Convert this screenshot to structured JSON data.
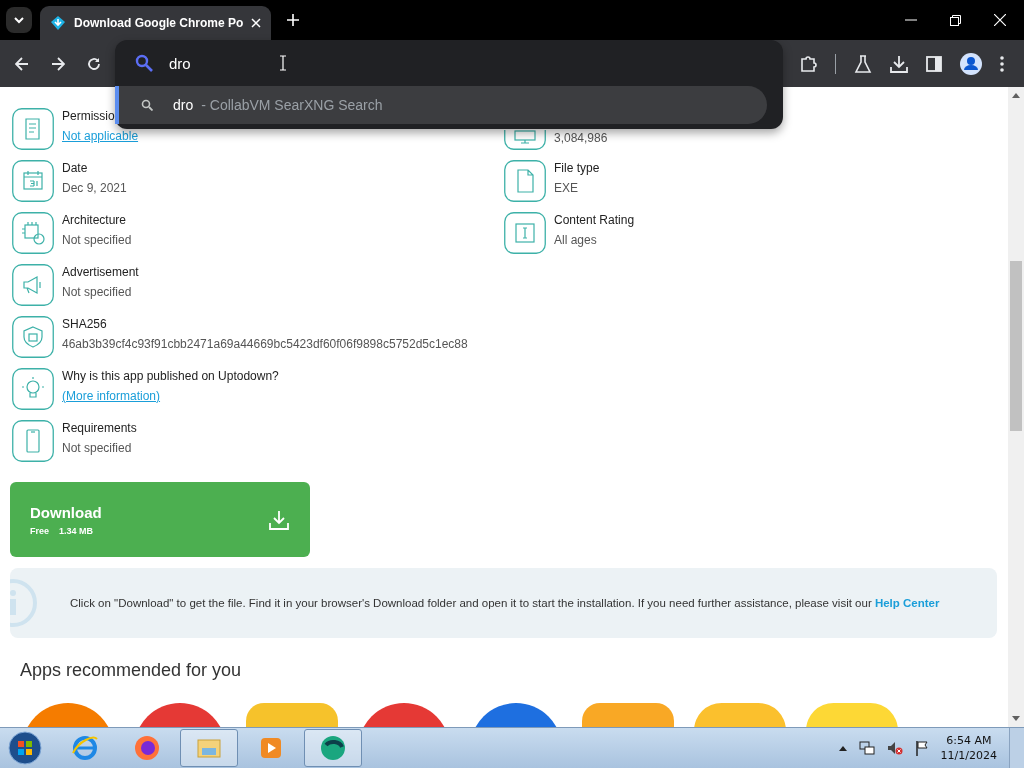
{
  "browser": {
    "tabs": [
      {
        "title": "Download Google Chrome Po",
        "selected": true
      }
    ],
    "omnibox": {
      "value": "dro"
    },
    "suggestions": [
      {
        "query": "dro",
        "source": "- CollabVM SearXNG Search",
        "selected": true
      }
    ]
  },
  "details": {
    "left": [
      {
        "kind": "permissions",
        "label": "Permissio",
        "value": "Not applicable",
        "link": true
      },
      {
        "kind": "date",
        "label": "Date",
        "value": "Dec 9, 2021",
        "link": false
      },
      {
        "kind": "architecture",
        "label": "Architecture",
        "value": "Not specified",
        "link": false
      },
      {
        "kind": "advertisement",
        "label": "Advertisement",
        "value": "Not specified",
        "link": false
      },
      {
        "kind": "sha",
        "label": "SHA256",
        "value": "46ab3b39cf4c93f91cbb2471a69a44669bc5423df60f06f9898c5752d5c1ec88",
        "link": false
      },
      {
        "kind": "info",
        "label": "Why is this app published on Uptodown?",
        "value": "(More information)",
        "link": true
      },
      {
        "kind": "requirements",
        "label": "Requirements",
        "value": "Not specified",
        "link": false
      }
    ],
    "right": [
      {
        "kind": "downloads",
        "value": "3,084,986",
        "link": false
      },
      {
        "kind": "filetype",
        "label": "File type",
        "value": "EXE",
        "link": false
      },
      {
        "kind": "rating",
        "label": "Content Rating",
        "value": "All ages",
        "link": false
      }
    ]
  },
  "download": {
    "label": "Download",
    "price": "Free",
    "size": "1.34 MB"
  },
  "notice": {
    "text": "Click on \"Download\" to get the file. Find it in your browser's Download folder and open it to start the installation. If you need further assistance, please visit our",
    "link": "Help Center"
  },
  "recommended": {
    "title": "Apps recommended for you"
  },
  "taskbar": {
    "apps": [
      {
        "kind": "ie",
        "open": false
      },
      {
        "kind": "firefox",
        "open": false
      },
      {
        "kind": "explorer",
        "open": true
      },
      {
        "kind": "media",
        "open": false
      },
      {
        "kind": "vm",
        "open": true
      }
    ],
    "clock": {
      "time": "6:54 AM",
      "date": "11/1/2024"
    }
  }
}
